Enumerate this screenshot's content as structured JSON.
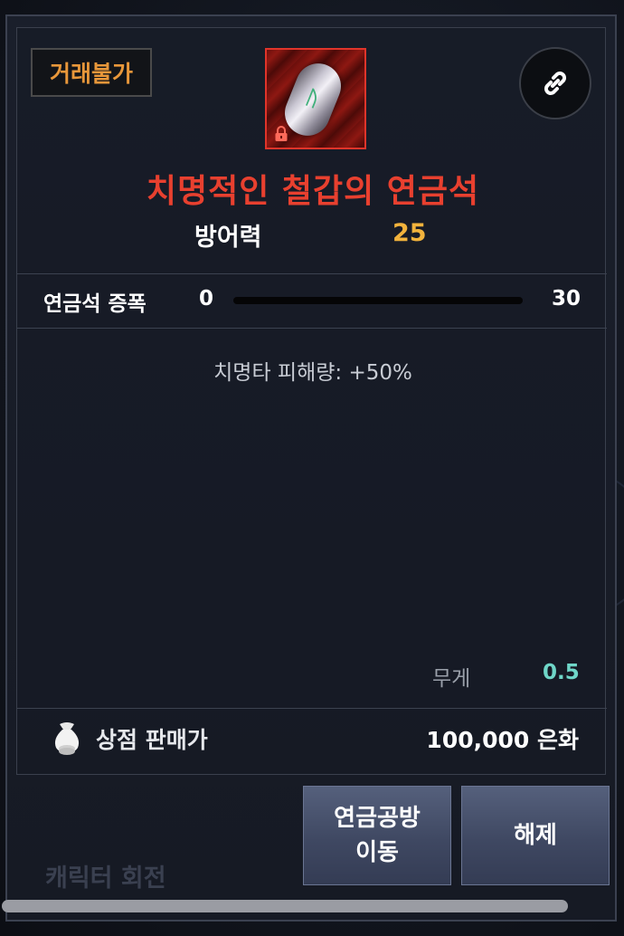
{
  "tooltip": {
    "trade_status": "거래불가",
    "item_name": "치명적인 철갑의 연금석",
    "icon": "alchemy-stone-icon",
    "lock_icon": "lock-icon",
    "link_icon": "link-icon",
    "stat": {
      "label": "방어력",
      "value": "25"
    },
    "amplification": {
      "label": "연금석 증폭",
      "min": "0",
      "max": "30",
      "current": 0
    },
    "effect": "치명타 피해량: +50%",
    "weight": {
      "label": "무게",
      "value": "0.5"
    },
    "shop_sell": {
      "icon": "money-bag-icon",
      "label": "상점 판매가",
      "value": "100,000 은화"
    }
  },
  "buttons": {
    "workshop": "연금공방\n이동",
    "release": "해제"
  },
  "background": {
    "rotate_label": "캐릭터 회전"
  },
  "colors": {
    "item_name": "#e8402f",
    "trade_status": "#e8973a",
    "stat_value": "#f2b33c",
    "weight_value": "#6fd6c8",
    "icon_border": "#e0342a"
  }
}
